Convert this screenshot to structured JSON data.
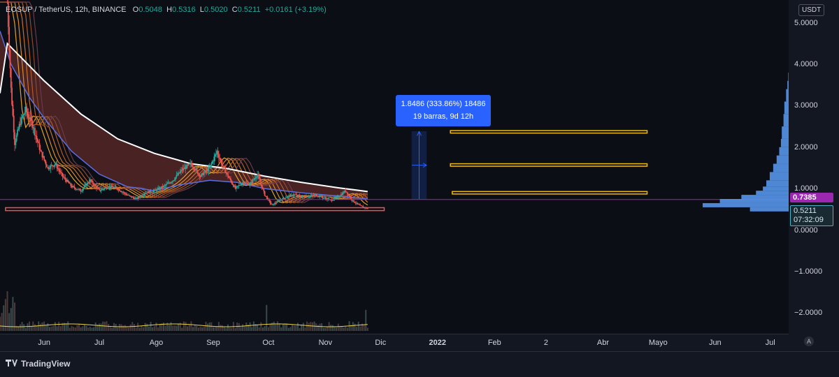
{
  "legend": {
    "symbol": "EOSUP / TetherUS, 12h, BINANCE",
    "o_label": "O",
    "o": "0.5048",
    "h_label": "H",
    "h": "0.5316",
    "l_label": "L",
    "l": "0.5020",
    "c_label": "C",
    "c": "0.5211",
    "change": "+0.0161 (+3.19%)"
  },
  "currency": "USDT",
  "badges": {
    "line_price": "0.7385",
    "last_price": "0.5211",
    "countdown": "07:32:09"
  },
  "measure": {
    "line1": "1.8486 (333.86%) 18486",
    "line2": "19 barras, 9d 12h"
  },
  "footer": {
    "brand": "TradingView",
    "auto_button": "A"
  },
  "colors": {
    "up": "#26a69a",
    "down": "#ef5350",
    "ema_white": "#ffffff",
    "ema_blue": "#5b6ee1",
    "ribbon": "#5e2a2a",
    "horizontal": "#9c27b0",
    "support": "#ef5350",
    "target": "#f0b90b",
    "profile": "#5b9cf6",
    "volume_ma": "#e8d24a"
  },
  "chart_data": {
    "type": "candlestick",
    "title": "EOSUP / TetherUS, 12h, BINANCE",
    "ylim": [
      -2.5,
      5.55
    ],
    "yticks": [
      5.0,
      4.0,
      3.0,
      2.0,
      1.0,
      0.0,
      -1.0,
      -2.0
    ],
    "ytick_labels": [
      "5.0000",
      "4.0000",
      "3.0000",
      "2.0000",
      "1.0000",
      "0.0000",
      "−1.0000",
      "−2.0000"
    ],
    "xticks": [
      "Jun",
      "Jul",
      "Ago",
      "Sep",
      "Oct",
      "Nov",
      "Dic",
      "2022",
      "Feb",
      "2",
      "Abr",
      "Mayo",
      "Jun",
      "Jul"
    ],
    "xticks_bold": [
      false,
      false,
      false,
      false,
      false,
      false,
      false,
      true,
      false,
      false,
      false,
      false,
      false,
      false
    ],
    "xlim_days": [
      -24,
      405
    ],
    "xtick_days": [
      0,
      30,
      61,
      92,
      122,
      153,
      183,
      214,
      245,
      273,
      304,
      334,
      365,
      395
    ],
    "price_path": [
      [
        -20,
        5.5
      ],
      [
        -18,
        3.4
      ],
      [
        -16,
        2.1
      ],
      [
        -13,
        2.6
      ],
      [
        -10,
        2.9
      ],
      [
        -6,
        2.5
      ],
      [
        -2,
        1.9
      ],
      [
        2,
        1.5
      ],
      [
        6,
        1.6
      ],
      [
        10,
        1.3
      ],
      [
        15,
        1.05
      ],
      [
        20,
        0.95
      ],
      [
        25,
        1.2
      ],
      [
        30,
        0.95
      ],
      [
        35,
        1.05
      ],
      [
        40,
        1.0
      ],
      [
        45,
        0.85
      ],
      [
        50,
        0.75
      ],
      [
        55,
        0.9
      ],
      [
        60,
        0.95
      ],
      [
        65,
        1.05
      ],
      [
        70,
        1.2
      ],
      [
        75,
        1.45
      ],
      [
        80,
        1.6
      ],
      [
        85,
        1.3
      ],
      [
        90,
        1.5
      ],
      [
        94,
        1.9
      ],
      [
        97,
        1.55
      ],
      [
        100,
        1.3
      ],
      [
        104,
        1.0
      ],
      [
        108,
        1.15
      ],
      [
        112,
        1.1
      ],
      [
        116,
        1.35
      ],
      [
        120,
        0.85
      ],
      [
        124,
        0.6
      ],
      [
        128,
        0.72
      ],
      [
        132,
        0.8
      ],
      [
        136,
        0.85
      ],
      [
        140,
        0.8
      ],
      [
        144,
        0.82
      ],
      [
        148,
        0.85
      ],
      [
        152,
        0.78
      ],
      [
        156,
        0.72
      ],
      [
        160,
        0.8
      ],
      [
        164,
        0.95
      ],
      [
        168,
        0.7
      ],
      [
        172,
        0.58
      ],
      [
        176,
        0.52
      ]
    ],
    "ema_white": [
      [
        -24,
        3.3
      ],
      [
        -20,
        4.5
      ],
      [
        -10,
        4.05
      ],
      [
        0,
        3.6
      ],
      [
        20,
        2.8
      ],
      [
        40,
        2.2
      ],
      [
        60,
        1.85
      ],
      [
        80,
        1.6
      ],
      [
        100,
        1.48
      ],
      [
        120,
        1.3
      ],
      [
        140,
        1.15
      ],
      [
        160,
        1.02
      ],
      [
        176,
        0.93
      ]
    ],
    "ema_blue": [
      [
        -24,
        4.8
      ],
      [
        -18,
        4.0
      ],
      [
        -8,
        3.2
      ],
      [
        0,
        2.7
      ],
      [
        15,
        1.9
      ],
      [
        30,
        1.35
      ],
      [
        45,
        1.05
      ],
      [
        60,
        0.95
      ],
      [
        75,
        1.1
      ],
      [
        90,
        1.2
      ],
      [
        105,
        1.15
      ],
      [
        120,
        1.0
      ],
      [
        140,
        0.9
      ],
      [
        160,
        0.82
      ],
      [
        176,
        0.75
      ]
    ],
    "horizontal_line": 0.7385,
    "support_zone": {
      "x": [
        -21,
        185
      ],
      "y": [
        0.47,
        0.54
      ]
    },
    "target_zones": [
      {
        "x": [
          221,
          328
        ],
        "y": [
          2.34,
          2.4
        ]
      },
      {
        "x": [
          221,
          328
        ],
        "y": [
          1.54,
          1.6
        ]
      },
      {
        "x": [
          222,
          328
        ],
        "y": [
          0.87,
          0.93
        ]
      }
    ],
    "measure_box": {
      "x": [
        200,
        208
      ],
      "y": [
        0.75,
        2.38
      ],
      "change": "1.8486 (333.86%)",
      "bars": 19,
      "duration": "9d 12h"
    },
    "last_price": 0.5211,
    "volume_profile": [
      [
        0.45,
        0.45
      ],
      [
        0.55,
        1.0
      ],
      [
        0.65,
        0.8
      ],
      [
        0.75,
        0.55
      ],
      [
        0.85,
        0.38
      ],
      [
        0.95,
        0.3
      ],
      [
        1.05,
        0.26
      ],
      [
        1.2,
        0.22
      ],
      [
        1.4,
        0.18
      ],
      [
        1.6,
        0.14
      ],
      [
        1.8,
        0.11
      ],
      [
        2.0,
        0.09
      ],
      [
        2.2,
        0.08
      ],
      [
        2.5,
        0.06
      ],
      [
        2.8,
        0.05
      ],
      [
        3.1,
        0.03
      ],
      [
        3.4,
        0.015
      ],
      [
        3.6,
        0.005
      ]
    ]
  }
}
